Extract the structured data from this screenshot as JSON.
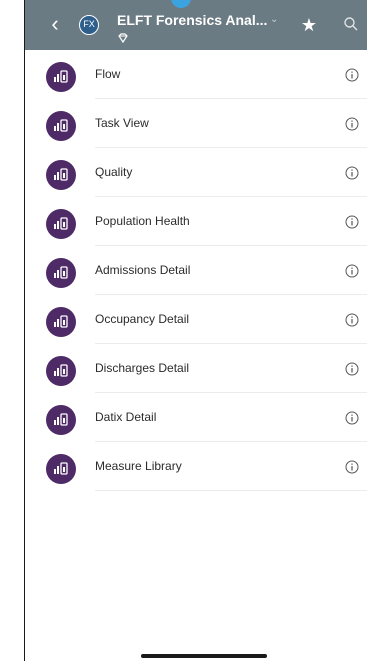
{
  "header": {
    "title": "ELFT Forensics Anal...",
    "badge_text": "FX",
    "back_icon": "chevron-left-icon",
    "chevron_icon": "chevron-down-icon",
    "star_icon": "star-icon",
    "search_icon": "search-icon",
    "subtitle_icon": "diamond-icon",
    "background_color": "#6b7b83"
  },
  "list": {
    "item_icon": "report-icon",
    "item_icon_color": "#4e2a66",
    "info_icon": "info-icon",
    "items": [
      {
        "label": "Flow"
      },
      {
        "label": "Task View"
      },
      {
        "label": "Quality"
      },
      {
        "label": "Population Health"
      },
      {
        "label": "Admissions Detail"
      },
      {
        "label": "Occupancy Detail"
      },
      {
        "label": "Discharges Detail"
      },
      {
        "label": "Datix Detail"
      },
      {
        "label": "Measure Library"
      }
    ]
  }
}
